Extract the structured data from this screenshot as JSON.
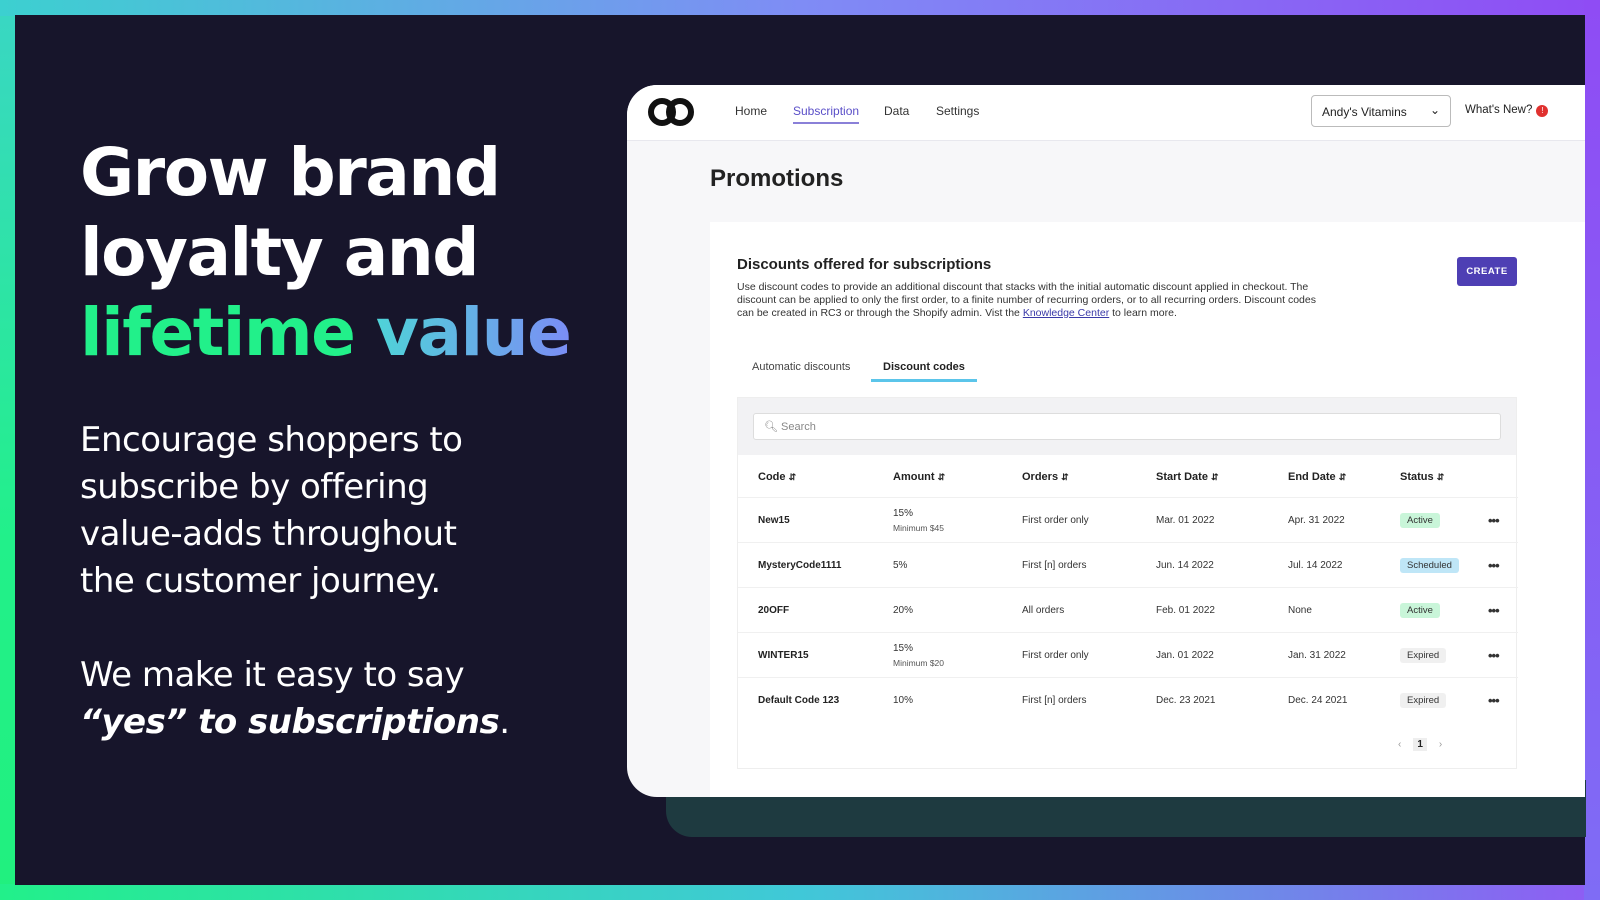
{
  "hero": {
    "line1": "Grow brand",
    "line2": "loyalty and",
    "line3a": "lifetime",
    "line3b": "value"
  },
  "para1": "Encourage shoppers to subscribe by offering value-adds throughout the customer journey.",
  "para2a": "We make it easy to say ",
  "para2b": "“yes” to subscriptions",
  "para2c": ".",
  "app": {
    "nav": {
      "items": [
        "Home",
        "Subscription",
        "Data",
        "Settings"
      ],
      "active": "Subscription",
      "store": "Andy's Vitamins",
      "whats_new": "What's New?",
      "badge": "!"
    },
    "page_title": "Promotions",
    "card": {
      "title": "Discounts offered for subscriptions",
      "desc_before": "Use discount codes to provide an additional discount that stacks with the initial automatic discount applied in checkout. The discount can be applied to only the first order, to a finite number of recurring orders, or to all recurring orders. Discount codes can be created in RC3 or through the Shopify admin. Vist the ",
      "desc_link": "Knowledge Center",
      "desc_after": " to learn more.",
      "create": "CREATE"
    },
    "tabs": [
      "Automatic discounts",
      "Discount codes"
    ],
    "search_placeholder": "Search",
    "columns": [
      "Code",
      "Amount",
      "Orders",
      "Start Date",
      "End Date",
      "Status"
    ],
    "rows": [
      {
        "code": "New15",
        "amount": "15%",
        "min": "Minimum $45",
        "orders": "First order only",
        "start": "Mar. 01 2022",
        "end": "Apr. 31 2022",
        "status": "Active"
      },
      {
        "code": "MysteryCode1111",
        "amount": "5%",
        "min": "",
        "orders": "First [n] orders",
        "start": "Jun. 14 2022",
        "end": "Jul. 14 2022",
        "status": "Scheduled"
      },
      {
        "code": "20OFF",
        "amount": "20%",
        "min": "",
        "orders": "All orders",
        "start": "Feb. 01 2022",
        "end": "None",
        "status": "Active"
      },
      {
        "code": "WINTER15",
        "amount": "15%",
        "min": "Minimum $20",
        "orders": "First order only",
        "start": "Jan. 01 2022",
        "end": "Jan. 31 2022",
        "status": "Expired"
      },
      {
        "code": "Default Code 123",
        "amount": "10%",
        "min": "",
        "orders": "First [n] orders",
        "start": "Dec. 23 2021",
        "end": "Dec. 24 2021",
        "status": "Expired"
      }
    ],
    "status_colors": {
      "Active": "#c9f5d9",
      "Scheduled": "#bfe6f7",
      "Expired": "#f0f0f0"
    },
    "pager": {
      "prev": "‹",
      "page": "1",
      "next": "›"
    }
  }
}
